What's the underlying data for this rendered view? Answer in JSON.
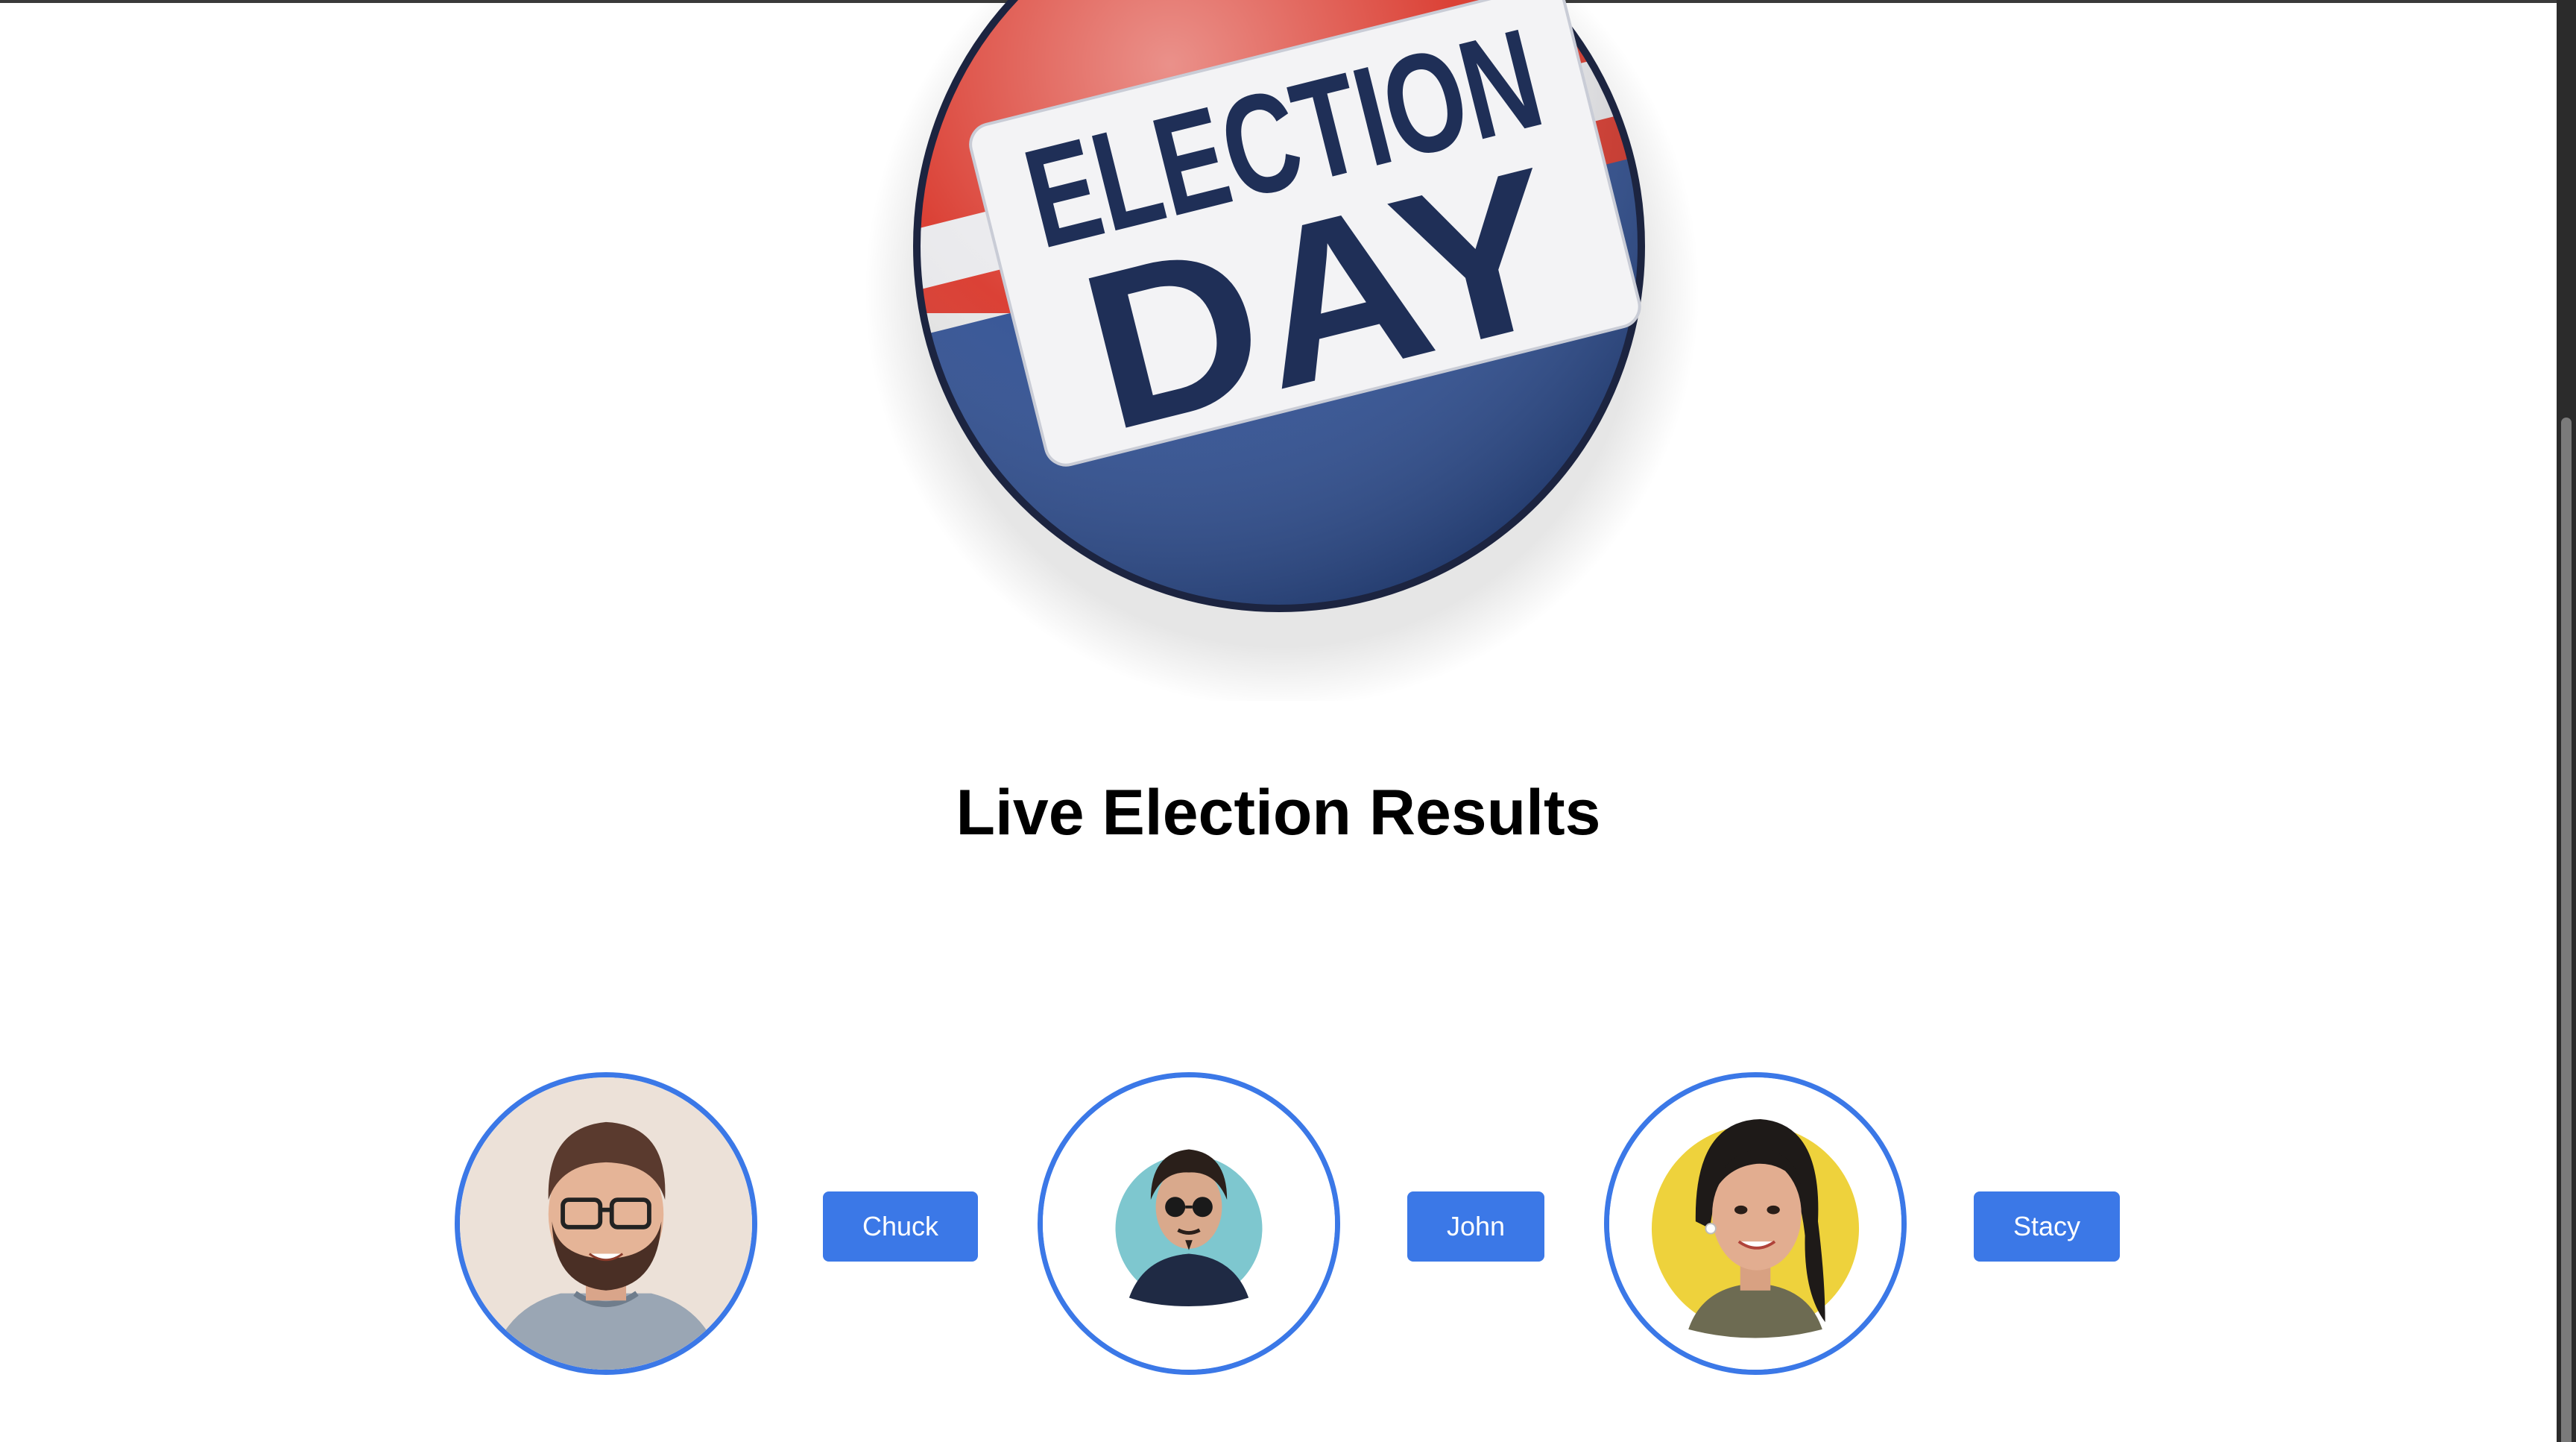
{
  "hero": {
    "badge_line1": "ELECTION",
    "badge_line2": "DAY"
  },
  "page": {
    "title": "Live Election Results"
  },
  "candidates": [
    {
      "name": "Chuck"
    },
    {
      "name": "John"
    },
    {
      "name": "Stacy"
    }
  ],
  "colors": {
    "accent": "#3b78e7",
    "badge_red": "#d9372b",
    "badge_blue": "#2f4f92",
    "badge_navy": "#1f2f57"
  }
}
